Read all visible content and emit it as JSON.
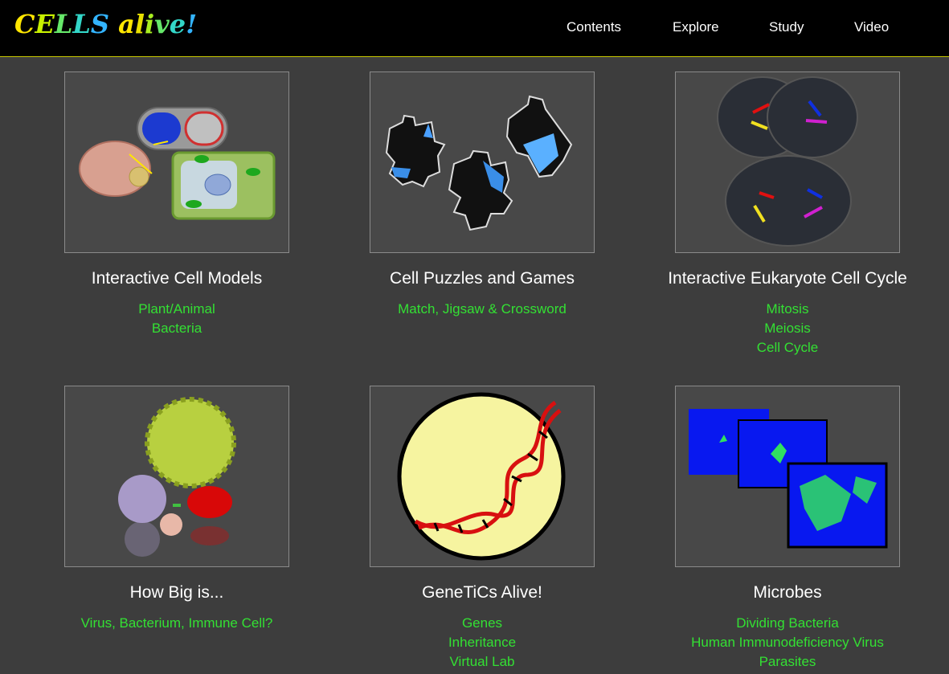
{
  "header": {
    "logo_text": "CELLS alive!",
    "nav": [
      "Contents",
      "Explore",
      "Study",
      "Video"
    ]
  },
  "colors": {
    "link": "#33e033",
    "background": "#3d3d3d",
    "header_border": "#c9c900"
  },
  "cards": [
    {
      "title": "Interactive Cell Models",
      "icon": "cell-models-image",
      "links": [
        "Plant/Animal",
        "Bacteria"
      ]
    },
    {
      "title": "Cell Puzzles and Games",
      "icon": "puzzle-pieces-image",
      "links": [
        "Match, Jigsaw & Crossword"
      ]
    },
    {
      "title": "Interactive Eukaryote Cell Cycle",
      "icon": "cell-division-image",
      "links": [
        "Mitosis",
        "Meiosis",
        "Cell Cycle"
      ]
    },
    {
      "title": "How Big is...",
      "icon": "size-comparison-image",
      "links": [
        "Virus, Bacterium, Immune Cell?"
      ]
    },
    {
      "title": "GeneTiCs Alive!",
      "icon": "dna-helix-image",
      "links": [
        "Genes",
        "Inheritance",
        "Virtual Lab"
      ]
    },
    {
      "title": "Microbes",
      "icon": "microbes-image",
      "links": [
        "Dividing Bacteria",
        "Human Immunodeficiency Virus",
        "Parasites"
      ]
    }
  ]
}
